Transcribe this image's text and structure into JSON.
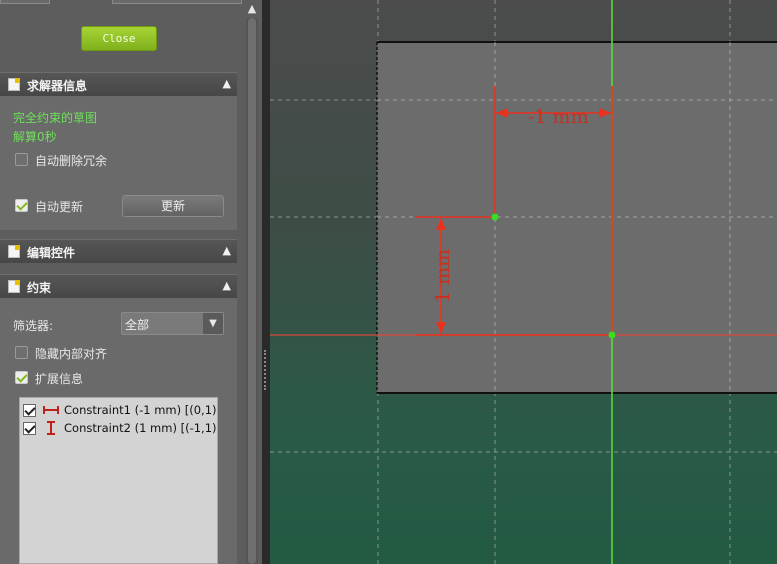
{
  "panel": {
    "close_label": "Close",
    "sections": {
      "solver": {
        "title": "求解器信息",
        "status": "完全约束的草图",
        "solve_time": "解算0秒",
        "auto_remove_redundant": {
          "label": "自动删除冗余",
          "checked": false
        },
        "auto_update": {
          "label": "自动更新",
          "checked": true
        },
        "update_label": "更新"
      },
      "edit_controls": {
        "title": "编辑控件"
      },
      "constraints": {
        "title": "约束",
        "filter_label": "筛选器:",
        "filter_value": "全部",
        "hide_internal": {
          "label": "隐藏内部对齐",
          "checked": false
        },
        "extended_info": {
          "label": "扩展信息",
          "checked": true
        },
        "items": [
          {
            "text": "Constraint1 (-1 mm) [(0,1)]",
            "icon": "horizontal-distance-icon",
            "checked": true
          },
          {
            "text": "Constraint2 (1 mm) [(-1,1),",
            "icon": "vertical-distance-icon",
            "checked": true
          }
        ]
      }
    }
  },
  "view": {
    "dim_horizontal": "-1 mm",
    "dim_vertical": "1 mm",
    "colors": {
      "constraint_red": "#e8321e",
      "axis_green": "#5de03a",
      "axis_red": "#d84a3a",
      "point_green": "#35e020",
      "sketch_face": "#6c6c6c"
    }
  },
  "colors": {
    "accent_green": "#8bc21c",
    "status_green": "#6ee05a"
  }
}
